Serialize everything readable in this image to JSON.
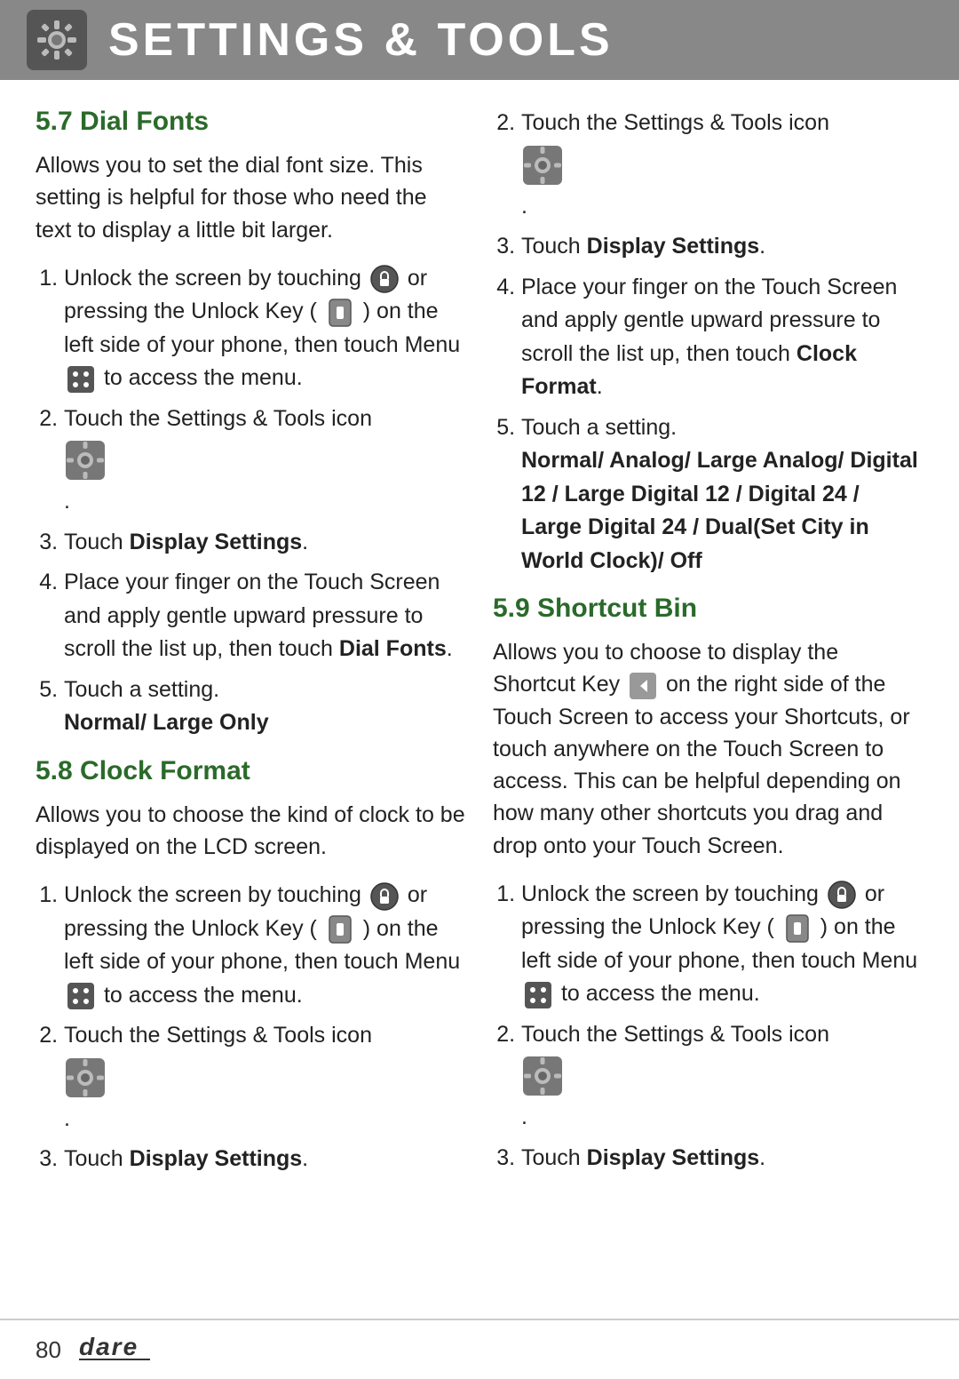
{
  "header": {
    "title": "SETTINGS & TOOLS",
    "icon_label": "settings-tools-icon"
  },
  "footer": {
    "page_number": "80",
    "brand": "Dare"
  },
  "left_column": {
    "section_57": {
      "title": "5.7 Dial Fonts",
      "description": "Allows you to set the dial font size. This setting is helpful for those who need the text to display a little bit larger.",
      "steps": [
        {
          "id": 1,
          "text_parts": [
            {
              "type": "text",
              "value": "Unlock the screen by touching "
            },
            {
              "type": "icon",
              "name": "lock-icon"
            },
            {
              "type": "text",
              "value": " or pressing the Unlock Key ("
            },
            {
              "type": "icon",
              "name": "unlock-key-icon"
            },
            {
              "type": "text",
              "value": ") on the left side of your phone, then touch Menu "
            },
            {
              "type": "icon",
              "name": "menu-icon"
            },
            {
              "type": "text",
              "value": " to access the menu."
            }
          ]
        },
        {
          "id": 2,
          "text_parts": [
            {
              "type": "text",
              "value": "Touch the Settings & Tools icon "
            },
            {
              "type": "icon",
              "name": "settings-tools-icon"
            },
            {
              "type": "text",
              "value": "."
            }
          ]
        },
        {
          "id": 3,
          "text": "Touch ",
          "bold_text": "Display Settings",
          "text_after": "."
        },
        {
          "id": 4,
          "text": "Place your finger on the Touch Screen and apply gentle upward pressure to scroll the list up, then touch ",
          "bold_text": "Dial Fonts",
          "text_after": "."
        },
        {
          "id": 5,
          "text": "Touch a setting.",
          "bold_text": "Normal/ Large Only",
          "bold_on_new_line": true
        }
      ]
    },
    "section_58": {
      "title": "5.8 Clock Format",
      "description": "Allows you to choose the kind of clock to be displayed on the LCD screen.",
      "steps": [
        {
          "id": 1,
          "text_parts": [
            {
              "type": "text",
              "value": "Unlock the screen by touching "
            },
            {
              "type": "icon",
              "name": "lock-icon"
            },
            {
              "type": "text",
              "value": " or pressing the Unlock Key ("
            },
            {
              "type": "icon",
              "name": "unlock-key-icon"
            },
            {
              "type": "text",
              "value": ") on the left side of your phone, then touch Menu "
            },
            {
              "type": "icon",
              "name": "menu-icon"
            },
            {
              "type": "text",
              "value": " to access the menu."
            }
          ]
        },
        {
          "id": 2,
          "text_parts": [
            {
              "type": "text",
              "value": "Touch the Settings & Tools icon "
            },
            {
              "type": "icon",
              "name": "settings-tools-icon"
            },
            {
              "type": "text",
              "value": "."
            }
          ]
        },
        {
          "id": 3,
          "text": "Touch ",
          "bold_text": "Display Settings",
          "text_after": "."
        }
      ]
    }
  },
  "right_column": {
    "section_58_cont": {
      "steps": [
        {
          "id": 2,
          "text_parts": [
            {
              "type": "text",
              "value": "Touch the Settings & Tools icon "
            },
            {
              "type": "icon",
              "name": "settings-tools-icon"
            },
            {
              "type": "text",
              "value": "."
            }
          ]
        },
        {
          "id": 3,
          "text": "Touch ",
          "bold_text": "Display Settings",
          "text_after": "."
        },
        {
          "id": 4,
          "text": "Place your finger on the Touch Screen and apply gentle upward pressure to scroll the list up, then touch ",
          "bold_text": "Clock Format",
          "text_after": "."
        },
        {
          "id": 5,
          "text": "Touch a setting.",
          "bold_text": "Normal/ Analog/ Large Analog/ Digital 12 / Large Digital 12 / Digital 24 / Large Digital 24 / Dual(Set City in World Clock)/ Off",
          "bold_on_new_line": true
        }
      ]
    },
    "section_59": {
      "title": "5.9 Shortcut Bin",
      "description_parts": [
        {
          "type": "text",
          "value": "Allows you to choose to display the Shortcut Key "
        },
        {
          "type": "icon",
          "name": "shortcut-key-icon"
        },
        {
          "type": "text",
          "value": " on the right side of the Touch Screen to access your Shortcuts, or touch anywhere on the Touch Screen to access. This can be helpful depending on how many other shortcuts you drag and drop onto your Touch Screen."
        }
      ],
      "steps": [
        {
          "id": 1,
          "text_parts": [
            {
              "type": "text",
              "value": "Unlock the screen by touching "
            },
            {
              "type": "icon",
              "name": "lock-icon"
            },
            {
              "type": "text",
              "value": " or pressing the Unlock Key ("
            },
            {
              "type": "icon",
              "name": "unlock-key-icon"
            },
            {
              "type": "text",
              "value": ") on the left side of your phone, then touch Menu "
            },
            {
              "type": "icon",
              "name": "menu-icon"
            },
            {
              "type": "text",
              "value": " to access the menu."
            }
          ]
        },
        {
          "id": 2,
          "text_parts": [
            {
              "type": "text",
              "value": "Touch the Settings & Tools icon "
            },
            {
              "type": "icon",
              "name": "settings-tools-icon"
            },
            {
              "type": "text",
              "value": "."
            }
          ]
        },
        {
          "id": 3,
          "text": "Touch ",
          "bold_text": "Display Settings",
          "text_after": "."
        }
      ]
    }
  },
  "labels": {
    "step3_touch": "Touch ",
    "step3_display_settings": "Display Settings",
    "step3_period": "."
  }
}
